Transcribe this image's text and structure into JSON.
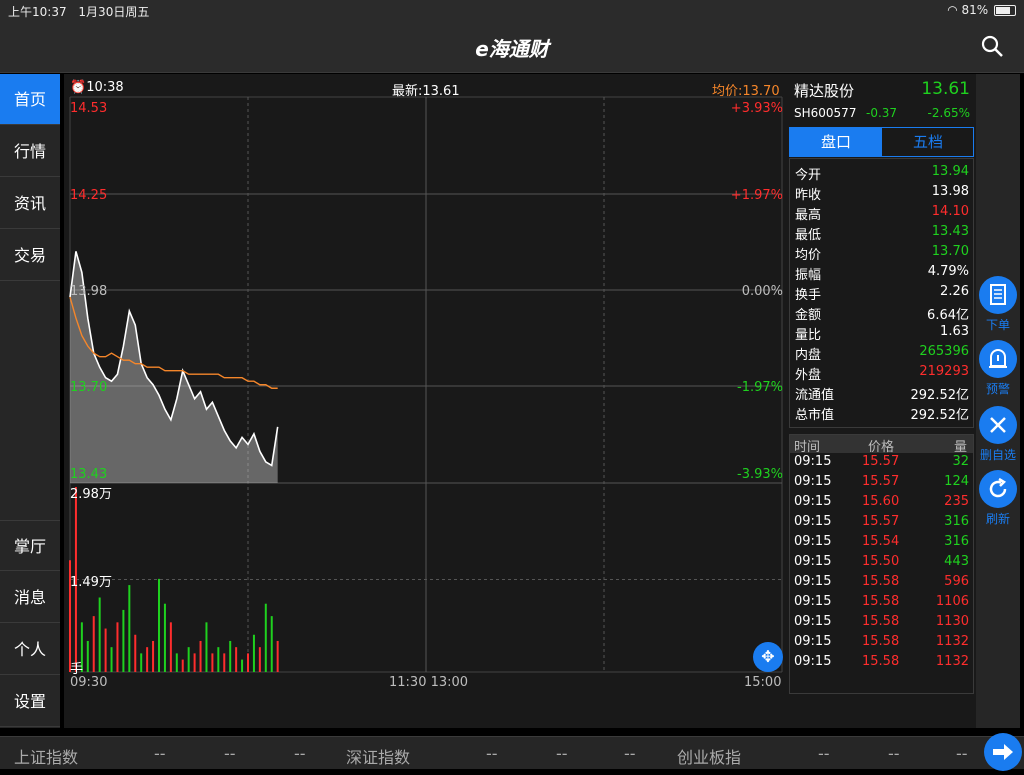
{
  "status_bar": {
    "time": "上午10:37",
    "date": "1月30日周五",
    "battery": "81%"
  },
  "nav": {
    "title": "e海通财"
  },
  "sidebar": {
    "top_items": [
      {
        "label": "首页",
        "active": true
      },
      {
        "label": "行情"
      },
      {
        "label": "资讯"
      },
      {
        "label": "交易"
      }
    ],
    "bottom_items": [
      {
        "label": "掌厅"
      },
      {
        "label": "消息"
      },
      {
        "label": "个人"
      },
      {
        "label": "设置"
      }
    ]
  },
  "chart_header": {
    "time": "10:38",
    "latest": "最新:13.61",
    "avg": "均价:13.70"
  },
  "price_axis": {
    "left": [
      "14.53",
      "14.25",
      "13.98",
      "13.70",
      "13.43"
    ],
    "right": [
      "+3.93%",
      "+1.97%",
      "0.00%",
      "-1.97%",
      "-3.93%"
    ]
  },
  "volume_axis": {
    "max": "2.98万",
    "mid": "1.49万",
    "unit": "手"
  },
  "time_axis": {
    "start": "09:30",
    "mid": "11:30 13:00",
    "end": "15:00"
  },
  "chart_data": {
    "type": "line",
    "ylim": [
      13.43,
      14.53
    ],
    "x": [
      0,
      2,
      4,
      6,
      8,
      10,
      12,
      14,
      16,
      18,
      20,
      22,
      24,
      26,
      28,
      30,
      32,
      34,
      36,
      38,
      40,
      42,
      44,
      46,
      48,
      50,
      52,
      54,
      56,
      58,
      60,
      62,
      64,
      66,
      68,
      70
    ],
    "series": [
      {
        "values": [
          13.96,
          14.09,
          14.03,
          13.9,
          13.8,
          13.76,
          13.73,
          13.72,
          13.74,
          13.82,
          13.92,
          13.88,
          13.77,
          13.73,
          13.71,
          13.68,
          13.64,
          13.61,
          13.67,
          13.75,
          13.71,
          13.67,
          13.69,
          13.64,
          13.66,
          13.62,
          13.58,
          13.55,
          13.53,
          13.56,
          13.54,
          13.57,
          13.52,
          13.49,
          13.48,
          13.59
        ]
      },
      {
        "values": [
          13.96,
          13.9,
          13.85,
          13.82,
          13.8,
          13.79,
          13.79,
          13.8,
          13.79,
          13.78,
          13.78,
          13.77,
          13.77,
          13.76,
          13.76,
          13.76,
          13.75,
          13.75,
          13.75,
          13.75,
          13.74,
          13.74,
          13.74,
          13.74,
          13.74,
          13.74,
          13.73,
          13.73,
          13.73,
          13.73,
          13.72,
          13.72,
          13.71,
          13.71,
          13.7,
          13.7
        ]
      }
    ],
    "volume": [
      18000,
      29800,
      8000,
      5000,
      9000,
      12000,
      7000,
      4000,
      8000,
      10000,
      14000,
      6000,
      3000,
      4000,
      5000,
      15000,
      11000,
      8000,
      3000,
      2000,
      4000,
      3000,
      5000,
      8000,
      3000,
      4000,
      3000,
      5000,
      4000,
      2000,
      3000,
      6000,
      4000,
      11000,
      9000,
      5000
    ],
    "volume_colors": [
      "red",
      "red",
      "green",
      "green",
      "red",
      "green",
      "red",
      "green",
      "red",
      "green",
      "green",
      "red",
      "green",
      "red",
      "red",
      "green",
      "green",
      "red",
      "green",
      "red",
      "green",
      "red",
      "red",
      "green",
      "red",
      "green",
      "red",
      "green",
      "red",
      "green",
      "red",
      "green",
      "red",
      "green",
      "green",
      "red"
    ]
  },
  "quote": {
    "name": "精达股份",
    "price": "13.61",
    "code": "SH600577",
    "change": "-0.37",
    "pct": "-2.65%",
    "tabs": [
      "盘口",
      "五档"
    ],
    "stats": [
      {
        "label": "今开",
        "value": "13.94",
        "color": "green"
      },
      {
        "label": "昨收",
        "value": "13.98",
        "color": "white"
      },
      {
        "label": "最高",
        "value": "14.10",
        "color": "red"
      },
      {
        "label": "最低",
        "value": "13.43",
        "color": "green"
      },
      {
        "label": "均价",
        "value": "13.70",
        "color": "green"
      },
      {
        "label": "振幅",
        "value": "4.79%",
        "color": "white"
      },
      {
        "label": "换手",
        "value": "2.26",
        "color": "white"
      },
      {
        "label": "金额",
        "value": "6.64亿",
        "color": "white"
      },
      {
        "label": "量比",
        "value": "1.63",
        "color": "white"
      },
      {
        "label": "内盘",
        "value": "265396",
        "color": "green"
      },
      {
        "label": "外盘",
        "value": "219293",
        "color": "red"
      },
      {
        "label": "流通值",
        "value": "292.52亿",
        "color": "white"
      },
      {
        "label": "总市值",
        "value": "292.52亿",
        "color": "white"
      }
    ],
    "ticks_header": {
      "time": "时间",
      "price": "价格",
      "vol": "量"
    },
    "ticks": [
      {
        "time": "09:15",
        "price": "15.57",
        "vol": "32",
        "color": "green"
      },
      {
        "time": "09:15",
        "price": "15.57",
        "vol": "124",
        "color": "green"
      },
      {
        "time": "09:15",
        "price": "15.60",
        "vol": "235",
        "color": "red"
      },
      {
        "time": "09:15",
        "price": "15.57",
        "vol": "316",
        "color": "green"
      },
      {
        "time": "09:15",
        "price": "15.54",
        "vol": "316",
        "color": "green"
      },
      {
        "time": "09:15",
        "price": "15.50",
        "vol": "443",
        "color": "green"
      },
      {
        "time": "09:15",
        "price": "15.58",
        "vol": "596",
        "color": "red"
      },
      {
        "time": "09:15",
        "price": "15.58",
        "vol": "1106",
        "color": "red"
      },
      {
        "time": "09:15",
        "price": "15.58",
        "vol": "1130",
        "color": "red"
      },
      {
        "time": "09:15",
        "price": "15.58",
        "vol": "1132",
        "color": "red"
      },
      {
        "time": "09:15",
        "price": "15.58",
        "vol": "1132",
        "color": "red"
      }
    ]
  },
  "actions": [
    {
      "label": "下单",
      "icon": "order-icon"
    },
    {
      "label": "预警",
      "icon": "alarm-icon"
    },
    {
      "label": "删自选",
      "icon": "close-icon"
    },
    {
      "label": "刷新",
      "icon": "refresh-icon"
    }
  ],
  "bottom_bar": {
    "indices": [
      {
        "name": "上证指数",
        "v1": "--",
        "v2": "--",
        "v3": "--"
      },
      {
        "name": "深证指数",
        "v1": "--",
        "v2": "--",
        "v3": "--"
      },
      {
        "name": "创业板指",
        "v1": "--",
        "v2": "--",
        "v3": "--"
      }
    ]
  },
  "colors": {
    "accent": "#1a7cf0",
    "up": "#ff2d2d",
    "down": "#1fd11f",
    "avg_line": "#f5862a"
  }
}
